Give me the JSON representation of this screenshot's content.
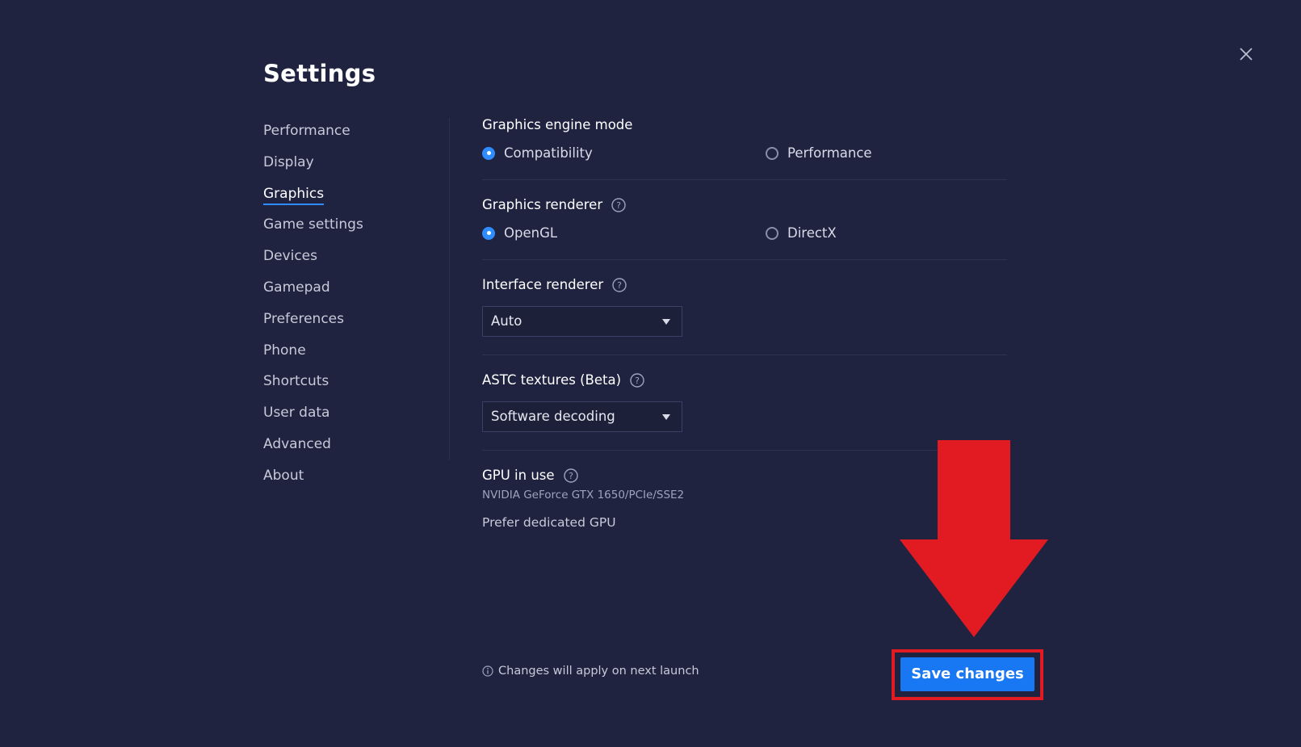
{
  "title": "Settings",
  "sidebar": {
    "items": [
      {
        "label": "Performance",
        "active": false
      },
      {
        "label": "Display",
        "active": false
      },
      {
        "label": "Graphics",
        "active": true
      },
      {
        "label": "Game settings",
        "active": false
      },
      {
        "label": "Devices",
        "active": false
      },
      {
        "label": "Gamepad",
        "active": false
      },
      {
        "label": "Preferences",
        "active": false
      },
      {
        "label": "Phone",
        "active": false
      },
      {
        "label": "Shortcuts",
        "active": false
      },
      {
        "label": "User data",
        "active": false
      },
      {
        "label": "Advanced",
        "active": false
      },
      {
        "label": "About",
        "active": false
      }
    ]
  },
  "graphics_engine": {
    "label": "Graphics engine mode",
    "options": [
      "Compatibility",
      "Performance"
    ],
    "selected": "Compatibility"
  },
  "graphics_renderer": {
    "label": "Graphics renderer",
    "options": [
      "OpenGL",
      "DirectX"
    ],
    "selected": "OpenGL"
  },
  "interface_renderer": {
    "label": "Interface renderer",
    "value": "Auto"
  },
  "astc": {
    "label": "ASTC textures (Beta)",
    "value": "Software decoding"
  },
  "gpu": {
    "label": "GPU in use",
    "name": "NVIDIA GeForce GTX 1650/PCIe/SSE2",
    "prefer_label": "Prefer dedicated GPU"
  },
  "footer": {
    "note": "Changes will apply on next launch",
    "save_label": "Save changes"
  },
  "colors": {
    "background": "#1f2340",
    "accent": "#2f8cff",
    "save_button": "#1877f2",
    "annotation_red": "#e21b23"
  },
  "icons": {
    "close": "close-icon",
    "help": "help-icon",
    "info": "info-icon",
    "annotation_arrow": "down-arrow-annotation"
  }
}
